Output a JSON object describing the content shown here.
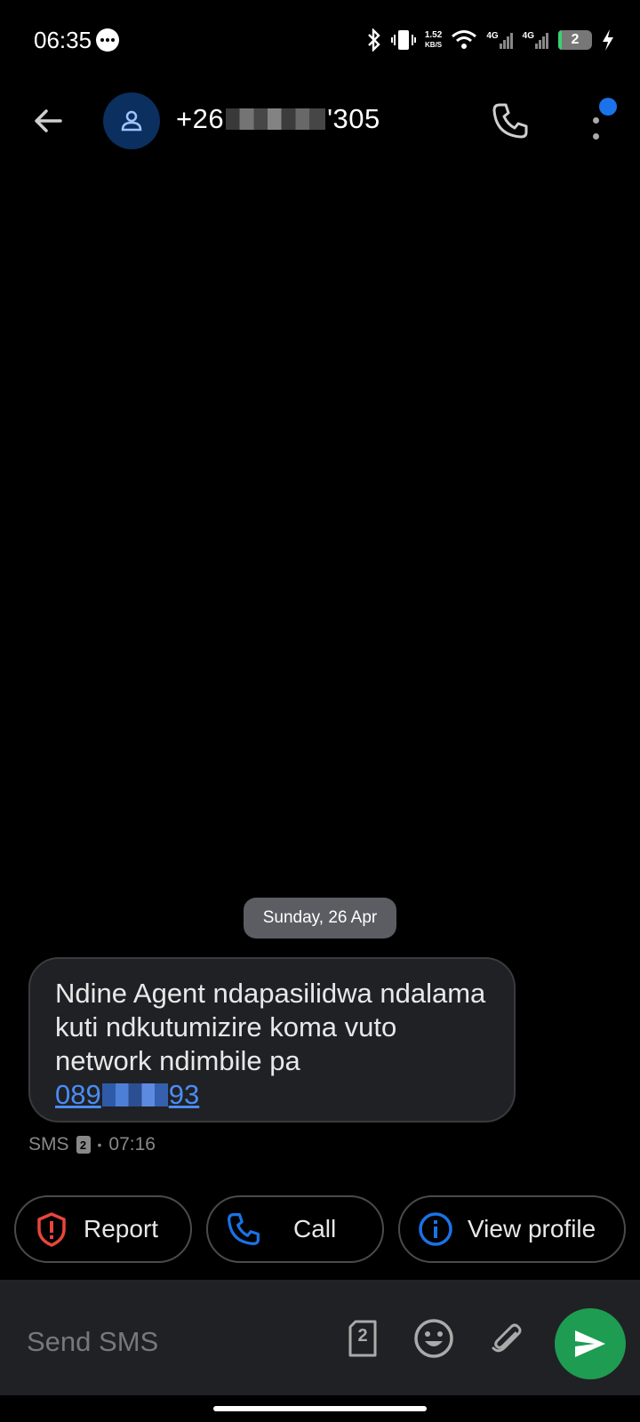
{
  "status_bar": {
    "time": "06:35",
    "net_speed_value": "1.52",
    "net_speed_unit": "KB/S",
    "sim1_type": "4G",
    "sim2_type": "4G",
    "battery_level": "2"
  },
  "header": {
    "contact_prefix": "+26",
    "contact_suffix": "'305"
  },
  "conversation": {
    "date_chip": "Sunday, 26 Apr",
    "message": {
      "text": "Ndine Agent ndapasilidwa ndalama kuti ndkutumizire koma vuto network ndimbile pa",
      "link_prefix": "089",
      "link_suffix": "93",
      "channel": "SMS",
      "sim_slot": "2",
      "separator": "•",
      "time": "07:16"
    }
  },
  "actions": {
    "report_label": "Report",
    "call_label": "Call",
    "view_profile_label": "View profile"
  },
  "composer": {
    "placeholder": "Send SMS",
    "sim_slot": "2"
  },
  "colors": {
    "accent_blue": "#1a73e8",
    "send_green": "#1e9c52",
    "report_red": "#e8453c",
    "bubble_bg": "#202124",
    "avatar_bg": "#0b2f5e"
  }
}
